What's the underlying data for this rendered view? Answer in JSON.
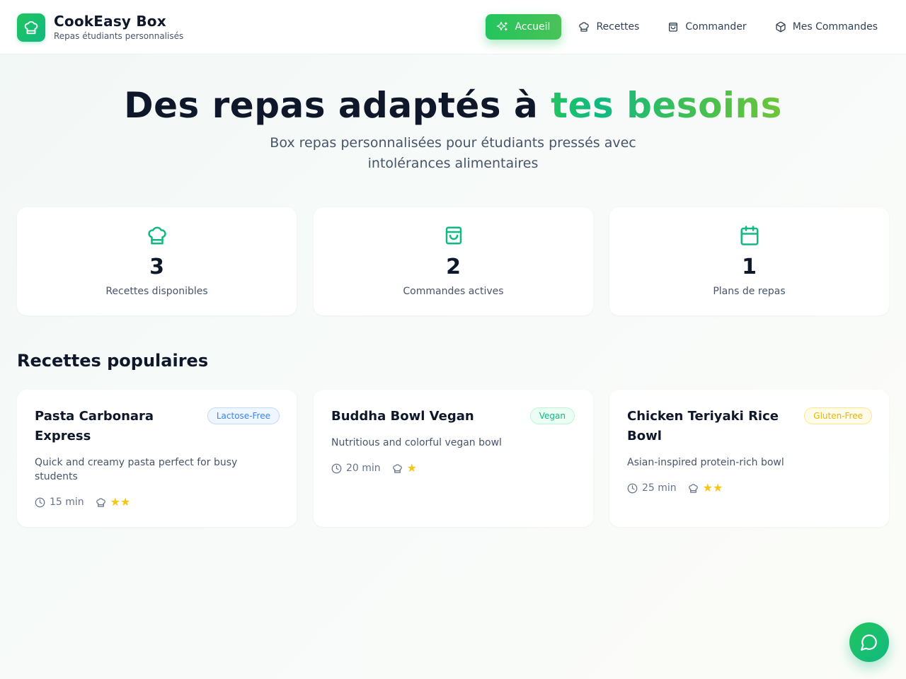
{
  "header": {
    "brand_title": "CookEasy Box",
    "brand_subtitle": "Repas étudiants personnalisés",
    "logo_icon": "chef-hat-icon",
    "nav": [
      {
        "label": "Accueil",
        "icon": "sparkles-icon",
        "active": true
      },
      {
        "label": "Recettes",
        "icon": "chef-hat-icon",
        "active": false
      },
      {
        "label": "Commander",
        "icon": "shopping-bag-icon",
        "active": false
      },
      {
        "label": "Mes Commandes",
        "icon": "package-icon",
        "active": false
      }
    ]
  },
  "hero": {
    "title_main": "Des repas adaptés à",
    "title_highlight": "tes besoins",
    "subtitle": "Box repas personnalisées pour étudiants pressés avec intolérances alimentaires"
  },
  "stats": [
    {
      "value": "3",
      "label": "Recettes disponibles",
      "icon": "chef-hat-icon"
    },
    {
      "value": "2",
      "label": "Commandes actives",
      "icon": "shopping-bag-icon"
    },
    {
      "value": "1",
      "label": "Plans de repas",
      "icon": "calendar-icon"
    }
  ],
  "popular": {
    "title": "Recettes populaires",
    "recipes": [
      {
        "title": "Pasta Carbonara Express",
        "badge": "Lactose-Free",
        "badge_color": "#3b82f6",
        "description": "Quick and creamy pasta perfect for busy students",
        "time": "15 min",
        "difficulty_stars": 2
      },
      {
        "title": "Buddha Bowl Vegan",
        "badge": "Vegan",
        "badge_color": "#10b981",
        "description": "Nutritious and colorful vegan bowl",
        "time": "20 min",
        "difficulty_stars": 1
      },
      {
        "title": "Chicken Teriyaki Rice Bowl",
        "badge": "Gluten-Free",
        "badge_color": "#eab308",
        "description": "Asian-inspired protein-rich bowl",
        "time": "25 min",
        "difficulty_stars": 2
      }
    ]
  },
  "chat": {
    "icon": "chat-bubble-icon"
  },
  "colors": {
    "accent": "#22c55e",
    "accent_alt": "#10b981",
    "text": "#0f172a",
    "muted": "#475569",
    "star": "#f5c518"
  }
}
